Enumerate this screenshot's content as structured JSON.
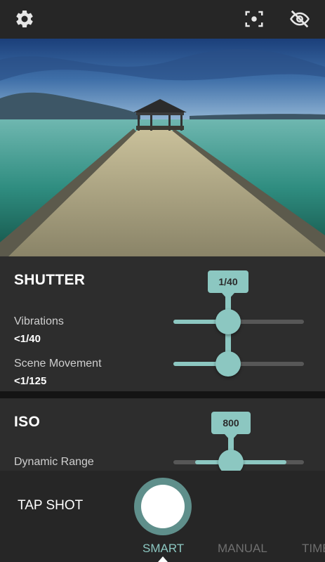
{
  "topbar": {
    "settings_icon": "gear-icon",
    "focus_icon": "focus-frame-icon",
    "hide_icon": "eye-off-icon"
  },
  "shutter": {
    "title": "SHUTTER",
    "bubble_value": "1/40",
    "rows": [
      {
        "label": "Vibrations",
        "value": "<1/40"
      },
      {
        "label": "Scene Movement",
        "value": "<1/125"
      }
    ]
  },
  "iso": {
    "title": "ISO",
    "bubble_value": "800",
    "rows": [
      {
        "label": "Dynamic Range"
      }
    ]
  },
  "capture": {
    "tap_shot": "TAP SHOT",
    "modes": [
      "SMART",
      "MANUAL",
      "TIMER"
    ],
    "active_mode": "SMART"
  },
  "colors": {
    "accent": "#8cc7c1",
    "panel": "#2d2d2d",
    "bar": "#262626",
    "shutter_ring": "#5f8f8b"
  }
}
